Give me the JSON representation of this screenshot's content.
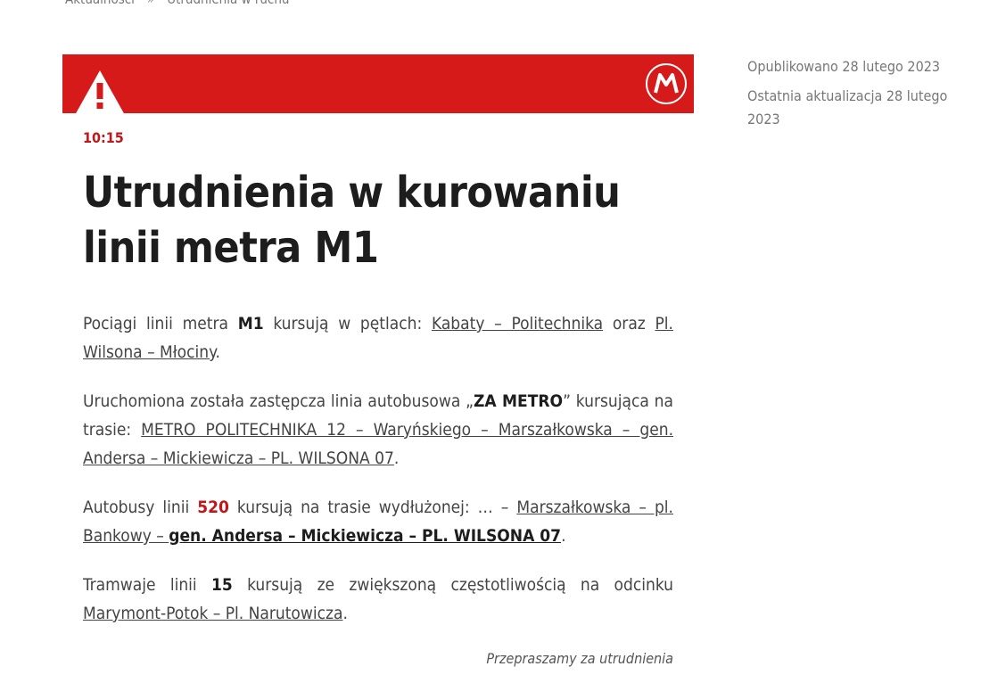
{
  "breadcrumb": {
    "items": [
      "Aktualności",
      "Utrudnienia w ruchu"
    ],
    "separator": "»"
  },
  "banner": {
    "color": "#d61a1a",
    "warning_icon": "warning-triangle-icon",
    "logo_text": "M"
  },
  "article": {
    "time": "10:15",
    "title": "Utrudnienia w kurowaniu linii metra M1",
    "p1": {
      "t1": "Pociągi linii metra ",
      "b1": "M1",
      "t2": " kursują w pętlach: ",
      "l1": "Kabaty – Politechnika",
      "t3": " oraz ",
      "l2": "Pl. Wilsona – Młociny",
      "t4": "."
    },
    "p2": {
      "t1": "Uruchomiona została zastępcza linia autobusowa „",
      "b1": "ZA METRO",
      "t2": "” kursująca na trasie: ",
      "l1": "METRO POLITECHNIKA 12 – Waryńskiego – Marszałkowska – gen. Andersa – Mickiewicza – PL. WILSONA 07",
      "t3": "."
    },
    "p3": {
      "t1": "Autobusy linii ",
      "r1": "520",
      "t2": " kursują na trasie wydłużonej: … – ",
      "l1": "Marszałkowska – pl. Bankowy – ",
      "lb1": "gen. Andersa – Mickiewicza – PL. WILSONA 07",
      "t3": "."
    },
    "p4": {
      "t1": "Tramwaje linii ",
      "b1": "15",
      "t2": " kursują ze zwiększoną częstotliwością na odcinku ",
      "l1": "Marymont-Potok – Pl. Narutowicza",
      "t3": "."
    },
    "apology": "Przepraszamy za utrudnienia"
  },
  "meta": {
    "published": "Opublikowano 28 lutego 2023",
    "updated": "Ostatnia aktualizacja 28 lutego 2023"
  }
}
